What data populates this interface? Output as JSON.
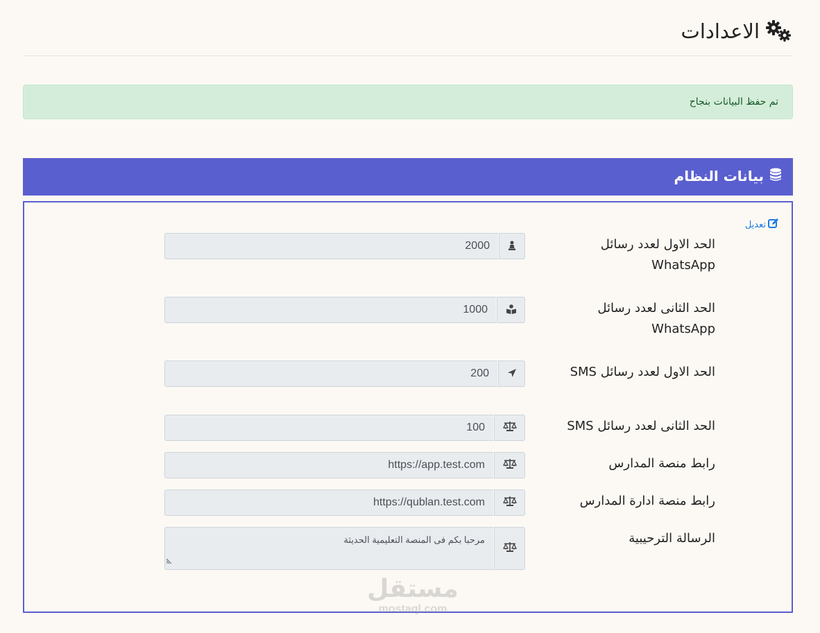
{
  "header": {
    "title": "الاعدادات",
    "icon": "gears-icon"
  },
  "alert": {
    "message": "تم حفظ البيانات بنجاح",
    "color": "#d4edda"
  },
  "card": {
    "title": "بيانات النظام",
    "icon": "database-icon",
    "accent": "#5a5fcf",
    "edit_label": "تعديل"
  },
  "fields": [
    {
      "label": "الحد الاول لعدد رسائل WhatsApp",
      "value": "2000",
      "icon": "chess-pawn-icon"
    },
    {
      "label": "الحد الثانى لعدد رسائل WhatsApp",
      "value": "1000",
      "icon": "book-reader-icon"
    },
    {
      "label": "الحد الاول لعدد رسائل SMS",
      "value": "200",
      "icon": "location-arrow-icon"
    },
    {
      "label": "الحد الثانى لعدد رسائل SMS",
      "value": "100",
      "icon": "balance-scale-icon"
    },
    {
      "label": "رابط منصة المدارس",
      "value": "https://app.test.com",
      "icon": "balance-scale-icon"
    },
    {
      "label": "رابط منصة ادارة المدارس",
      "value": "https://qublan.test.com",
      "icon": "balance-scale-icon"
    },
    {
      "label": "الرسالة الترحيبية",
      "value": "مرحبا بكم فى المنصة التعليمية الحديثة",
      "icon": "balance-scale-icon"
    }
  ],
  "watermark": {
    "arabic": "مستقل",
    "english": "mostaql.com"
  }
}
